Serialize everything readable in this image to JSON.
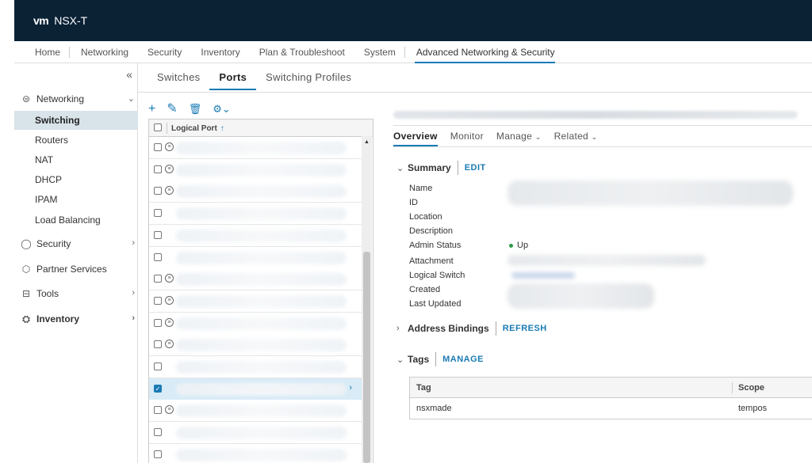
{
  "app": {
    "logo": "vm",
    "title": "NSX-T"
  },
  "mainnav": [
    "Home",
    "Networking",
    "Security",
    "Inventory",
    "Plan & Troubleshoot",
    "System",
    "Advanced Networking & Security"
  ],
  "mainnav_active": "Advanced Networking & Security",
  "sidebar": {
    "collapse_glyph": "«",
    "networking": "Networking",
    "items": [
      "Switching",
      "Routers",
      "NAT",
      "DHCP",
      "IPAM",
      "Load Balancing"
    ],
    "selected": "Switching",
    "security": "Security",
    "partner": "Partner Services",
    "tools": "Tools",
    "inventory": "Inventory"
  },
  "tabs": [
    "Switches",
    "Ports",
    "Switching Profiles"
  ],
  "active_tab": "Ports",
  "toolbar": {
    "add": "+",
    "edit": "✎",
    "delete": "🗑",
    "settings": "⚙⌄"
  },
  "grid": {
    "column": "Logical Port",
    "sort_glyph": "↑",
    "row_count": 15,
    "selected_row": 11,
    "expand_glyph": "›"
  },
  "detail": {
    "tabs": [
      {
        "label": "Overview",
        "caret": ""
      },
      {
        "label": "Monitor",
        "caret": ""
      },
      {
        "label": "Manage",
        "caret": "⌄"
      },
      {
        "label": "Related",
        "caret": "⌄"
      }
    ],
    "summary": {
      "title": "Summary",
      "action": "EDIT"
    },
    "fields": [
      "Name",
      "ID",
      "Location",
      "Description",
      "Admin Status",
      "Attachment",
      "Logical Switch",
      "Created",
      "Last Updated"
    ],
    "admin_status": "Up",
    "address_bindings": {
      "title": "Address Bindings",
      "action": "REFRESH"
    },
    "tags": {
      "title": "Tags",
      "action": "MANAGE",
      "columns": [
        "Tag",
        "Scope"
      ],
      "rows": [
        {
          "tag": "nsxmade",
          "scope": "tempos"
        }
      ]
    }
  },
  "colors": {
    "header": "#0b2235",
    "accent": "#1a7bb5",
    "selected": "#d8e3ea",
    "status_up": "#2e9b4a"
  }
}
